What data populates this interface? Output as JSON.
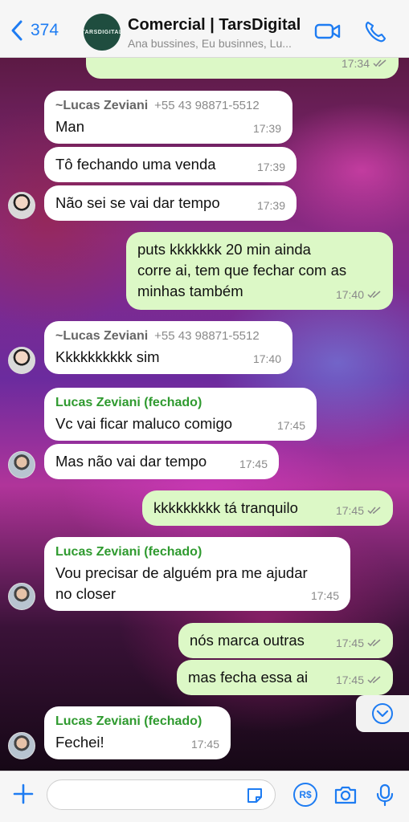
{
  "header": {
    "back_count": "374",
    "group_avatar_text": "TARSDIGITAL",
    "group_name": "Comercial | TarsDigital",
    "members": "Ana bussines, Eu businnes, Lu..."
  },
  "messages": [
    {
      "text": "",
      "time": "17:34"
    },
    {
      "sender": "~Lucas Zeviani",
      "phone": "+55 43 98871-5512",
      "text": "Man",
      "time": "17:39"
    },
    {
      "text": "Tô fechando uma venda",
      "time": "17:39"
    },
    {
      "text": "Não sei se vai dar tempo",
      "time": "17:39"
    },
    {
      "text_lines": [
        "puts kkkkkkk 20 min ainda",
        "corre ai, tem que fechar com as",
        "minhas também"
      ],
      "time": "17:40"
    },
    {
      "sender": "~Lucas Zeviani",
      "phone": "+55 43 98871-5512",
      "text": "Kkkkkkkkkk sim",
      "time": "17:40"
    },
    {
      "sender": "Lucas Zeviani (fechado)",
      "text": "Vc vai ficar maluco comigo",
      "time": "17:45"
    },
    {
      "text": "Mas não vai dar tempo",
      "time": "17:45"
    },
    {
      "text": "kkkkkkkkk tá tranquilo",
      "time": "17:45"
    },
    {
      "sender": "Lucas Zeviani (fechado)",
      "text_lines": [
        "Vou precisar de alguém pra me ajudar",
        "no closer"
      ],
      "time": "17:45"
    },
    {
      "text": "nós marca outras",
      "time": "17:45"
    },
    {
      "text": "mas fecha essa ai",
      "time": "17:45"
    },
    {
      "sender": "Lucas Zeviani (fechado)",
      "text": "Fechei!",
      "time": "17:45"
    }
  ],
  "footer": {
    "input_placeholder": "",
    "currency_label": "R$"
  },
  "colors": {
    "accent": "#1e7cf2",
    "outgoing": "#dcf8c6",
    "incoming": "#ffffff",
    "sender_green": "#2f9a2f"
  }
}
